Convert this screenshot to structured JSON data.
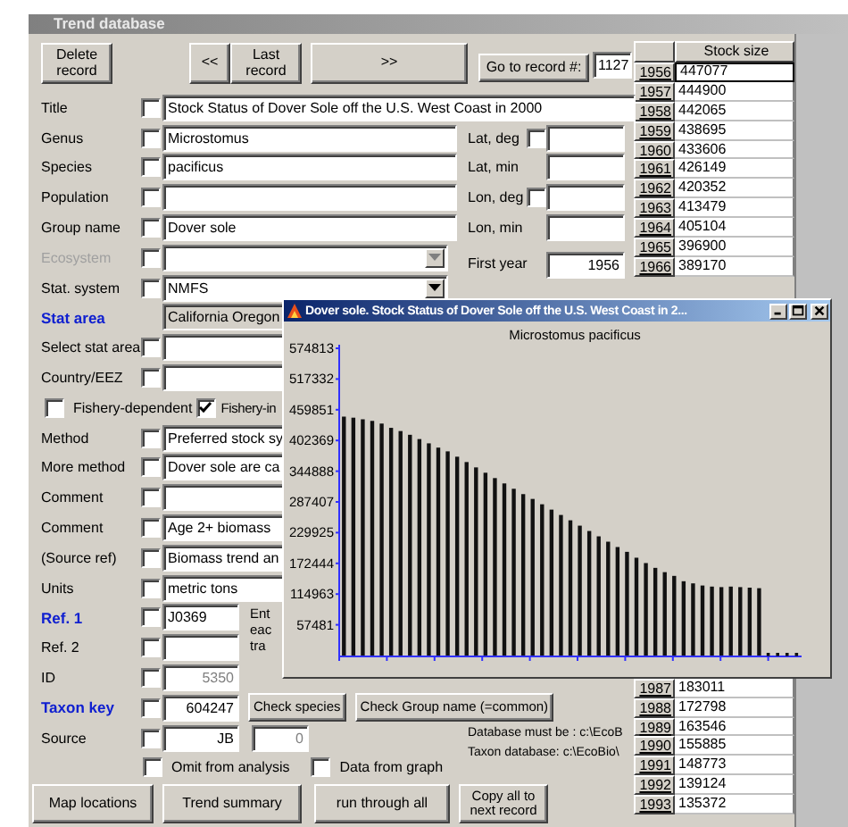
{
  "window": {
    "title": "Trend database"
  },
  "toolbar": [
    {
      "label": "Delete record"
    },
    {
      "label": "<<"
    },
    {
      "label": "Last record"
    },
    {
      "label": ">>"
    }
  ],
  "goto": {
    "label": "Go to record #:",
    "value": "1127"
  },
  "upper_fields": [
    {
      "label": "Title",
      "kind": "wide",
      "value": "Stock Status of Dover Sole off the U.S. West Coast in 2000",
      "checked": false,
      "disabled": false
    },
    {
      "label": "Genus",
      "kind": "text",
      "value": "Microstomus",
      "checked": false,
      "disabled": false
    },
    {
      "label": "Species",
      "kind": "text",
      "value": "pacificus",
      "checked": false,
      "disabled": false
    },
    {
      "label": "Population",
      "kind": "text",
      "checked": false,
      "disabled": false
    },
    {
      "label": "Group name",
      "kind": "text",
      "value": "Dover sole",
      "checked": false,
      "disabled": false
    },
    {
      "label": "Ecosystem",
      "kind": "combo",
      "checked": false,
      "disabled": true
    },
    {
      "label": "Stat. system",
      "kind": "combo",
      "value": "NMFS",
      "checked": false,
      "disabled": false
    }
  ],
  "location": [
    {
      "label": "Lat, deg",
      "kind": "check",
      "checked": false
    },
    {
      "label": "Lat, min",
      "kind": "plain"
    },
    {
      "label": "Lon, deg",
      "kind": "check",
      "checked": false
    },
    {
      "label": "Lon, min",
      "kind": "plain"
    }
  ],
  "first_year": {
    "label": "First year",
    "value": "1956"
  },
  "stat_area": {
    "label": "Stat area",
    "value": "California Oregon"
  },
  "area_fields": [
    {
      "label": "Select stat area",
      "checked": false
    },
    {
      "label": "Country/EEZ",
      "checked": false
    }
  ],
  "fishery": [
    {
      "label": "Fishery-dependent",
      "checked": false
    },
    {
      "label": "Fishery-in",
      "checked": true
    }
  ],
  "lower_fields": [
    {
      "label": "Method",
      "kind": "text",
      "value": "Preferred stock sy",
      "checked": false,
      "emphasis": false,
      "locked": false
    },
    {
      "label": "More method",
      "kind": "text",
      "value": "Dover sole are ca",
      "checked": false,
      "emphasis": false,
      "locked": false
    },
    {
      "label": "Comment",
      "kind": "text",
      "checked": false,
      "emphasis": false
    },
    {
      "label": "Comment",
      "kind": "text",
      "value": "Age 2+ biomass",
      "checked": false,
      "emphasis": false,
      "locked": false
    },
    {
      "label": "(Source ref)",
      "kind": "text",
      "value": "Biomass trend an",
      "checked": false,
      "emphasis": false,
      "locked": false
    },
    {
      "label": "Units",
      "kind": "text",
      "value": "metric tons",
      "checked": false,
      "emphasis": false,
      "locked": false
    },
    {
      "label": "Ref. 1",
      "kind": "short",
      "value": "J0369",
      "checked": false,
      "emphasis": true,
      "locked": false,
      "note": "Ent eac tra"
    },
    {
      "label": "Ref. 2",
      "kind": "short",
      "checked": false,
      "emphasis": false
    },
    {
      "label": "ID",
      "kind": "number",
      "value": "5350",
      "checked": false,
      "emphasis": false,
      "locked": true
    },
    {
      "label": "Taxon key",
      "kind": "number",
      "value": "604247",
      "checked": false,
      "emphasis": true,
      "locked": false,
      "buttons": [
        "Check species",
        "Check Group name (=common)"
      ]
    },
    {
      "label": "Source",
      "kind": "number",
      "value": "JB",
      "checked": false,
      "emphasis": false,
      "locked": false,
      "extra_value": "0",
      "notes": [
        "Database must be : c:\\EcoB",
        "Taxon database: c:\\EcoBio\\"
      ]
    }
  ],
  "options": [
    {
      "label": "Omit from analysis",
      "checked": false
    },
    {
      "label": "Data from graph",
      "checked": false
    }
  ],
  "actions": [
    "Map locations",
    "Trend summary",
    "run through all",
    "Copy all to next record"
  ],
  "stock_table": {
    "header": "Stock size",
    "rows": [
      {
        "year": "1956",
        "value": "447077",
        "selected": true
      },
      {
        "year": "1957",
        "value": "444900",
        "selected": false
      },
      {
        "year": "1958",
        "value": "442065",
        "selected": false
      },
      {
        "year": "1959",
        "value": "438695",
        "selected": false
      },
      {
        "year": "1960",
        "value": "433606",
        "selected": false
      },
      {
        "year": "1961",
        "value": "426149",
        "selected": false
      },
      {
        "year": "1962",
        "value": "420352",
        "selected": false
      },
      {
        "year": "1963",
        "value": "413479",
        "selected": false
      },
      {
        "year": "1964",
        "value": "405104",
        "selected": false
      },
      {
        "year": "1965",
        "value": "396900",
        "selected": false
      },
      {
        "year": "1966",
        "value": "389170",
        "selected": false
      }
    ],
    "rows_after_chart": [
      {
        "year": "1987",
        "value": "183011",
        "selected": false
      },
      {
        "year": "1988",
        "value": "172798",
        "selected": false
      },
      {
        "year": "1989",
        "value": "163546",
        "selected": false
      },
      {
        "year": "1990",
        "value": "155885",
        "selected": false
      },
      {
        "year": "1991",
        "value": "148773",
        "selected": false
      },
      {
        "year": "1992",
        "value": "139124",
        "selected": false
      },
      {
        "year": "1993",
        "value": "135372",
        "selected": false
      }
    ]
  },
  "chart_window": {
    "title": "Dover sole.  Stock Status of Dover Sole off the U.S. West Coast in 2...",
    "chart_data": {
      "type": "bar",
      "title": "Microstomus pacificus",
      "values": [
        447000,
        445000,
        442000,
        439000,
        434000,
        426000,
        420000,
        413000,
        405000,
        397000,
        389000,
        382000,
        372000,
        362000,
        352000,
        342000,
        332000,
        322000,
        312000,
        302000,
        293000,
        283000,
        273000,
        263000,
        253000,
        243000,
        233000,
        223000,
        213000,
        203000,
        194000,
        183000,
        173000,
        164000,
        156000,
        149000,
        139000,
        135000,
        131000,
        129000,
        128000,
        129000,
        128000,
        127000,
        126000,
        0,
        0,
        0,
        0
      ],
      "ylim": [
        0,
        574813
      ],
      "yticks": [
        57481,
        114963,
        172444,
        229925,
        287407,
        344888,
        402369,
        459851,
        517332,
        574813
      ]
    }
  }
}
